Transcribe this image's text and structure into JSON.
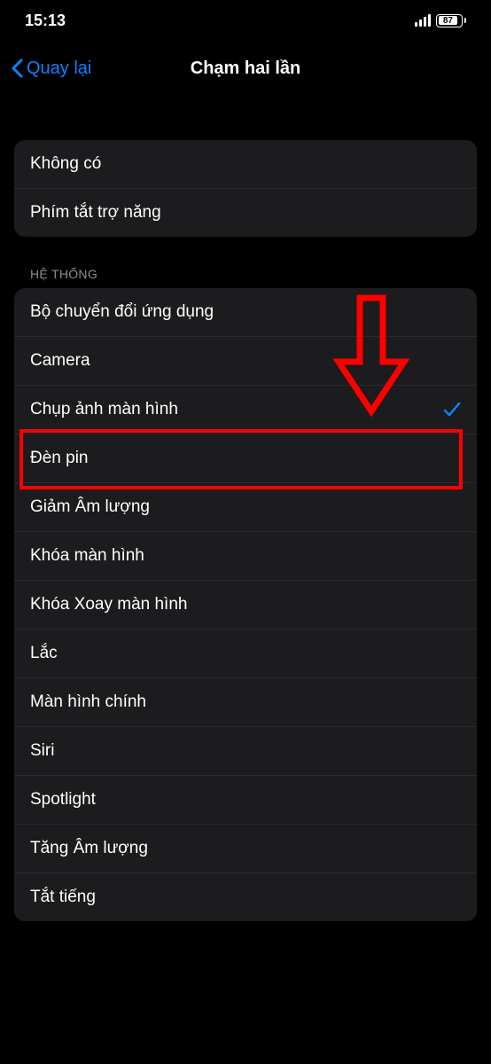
{
  "status": {
    "time": "15:13",
    "battery_pct": "87"
  },
  "nav": {
    "back_label": "Quay lại",
    "title": "Chạm hai lần"
  },
  "group1": {
    "items": [
      {
        "label": "Không có"
      },
      {
        "label": "Phím tắt trợ năng"
      }
    ]
  },
  "section2_header": "HỆ THỐNG",
  "group2": {
    "items": [
      {
        "label": "Bộ chuyển đổi ứng dụng",
        "selected": false
      },
      {
        "label": "Camera",
        "selected": false
      },
      {
        "label": "Chụp ảnh màn hình",
        "selected": true
      },
      {
        "label": "Đèn pin",
        "selected": false
      },
      {
        "label": "Giảm Âm lượng",
        "selected": false
      },
      {
        "label": "Khóa màn hình",
        "selected": false
      },
      {
        "label": "Khóa Xoay màn hình",
        "selected": false
      },
      {
        "label": "Lắc",
        "selected": false
      },
      {
        "label": "Màn hình chính",
        "selected": false
      },
      {
        "label": "Siri",
        "selected": false
      },
      {
        "label": "Spotlight",
        "selected": false
      },
      {
        "label": "Tăng Âm lượng",
        "selected": false
      },
      {
        "label": "Tắt tiếng",
        "selected": false
      }
    ]
  },
  "colors": {
    "accent": "#0a84ff",
    "annotation": "#ff0000"
  }
}
